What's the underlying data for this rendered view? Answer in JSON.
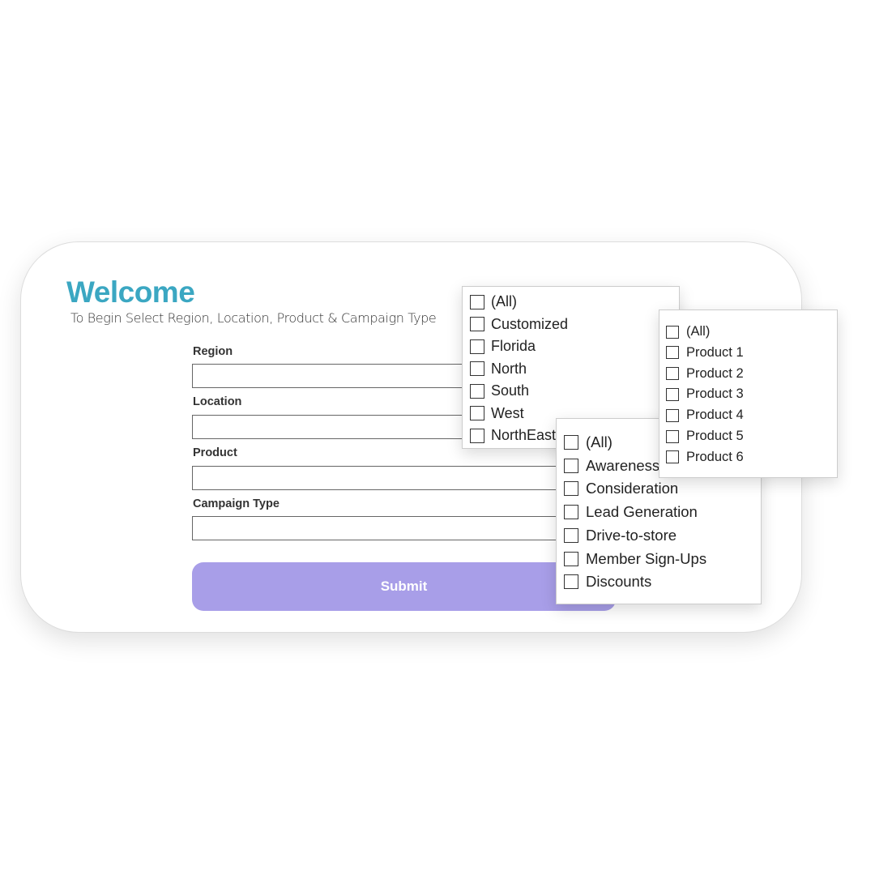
{
  "header": {
    "title": "Welcome",
    "subtitle": "To Begin Select Region, Location, Product & Campaign Type"
  },
  "form": {
    "fields": [
      {
        "label": "Region",
        "value": ""
      },
      {
        "label": "Location",
        "value": ""
      },
      {
        "label": "Product",
        "value": ""
      },
      {
        "label": "Campaign Type",
        "value": ""
      }
    ],
    "submit_label": "Submit"
  },
  "dropdowns": {
    "region": [
      "(All)",
      "Customized",
      "Florida",
      "North",
      "South",
      "West",
      "NorthEast"
    ],
    "campaign": [
      "(All)",
      "Awareness",
      "Consideration",
      "Lead Generation",
      "Drive-to-store",
      "Member Sign-Ups",
      "Discounts"
    ],
    "product": [
      "(All)",
      "Product 1",
      "Product 2",
      "Product 3",
      "Product 4",
      "Product 5",
      "Product 6"
    ]
  },
  "colors": {
    "accent": "#3ba7c2",
    "submit": "#a89ee8"
  }
}
